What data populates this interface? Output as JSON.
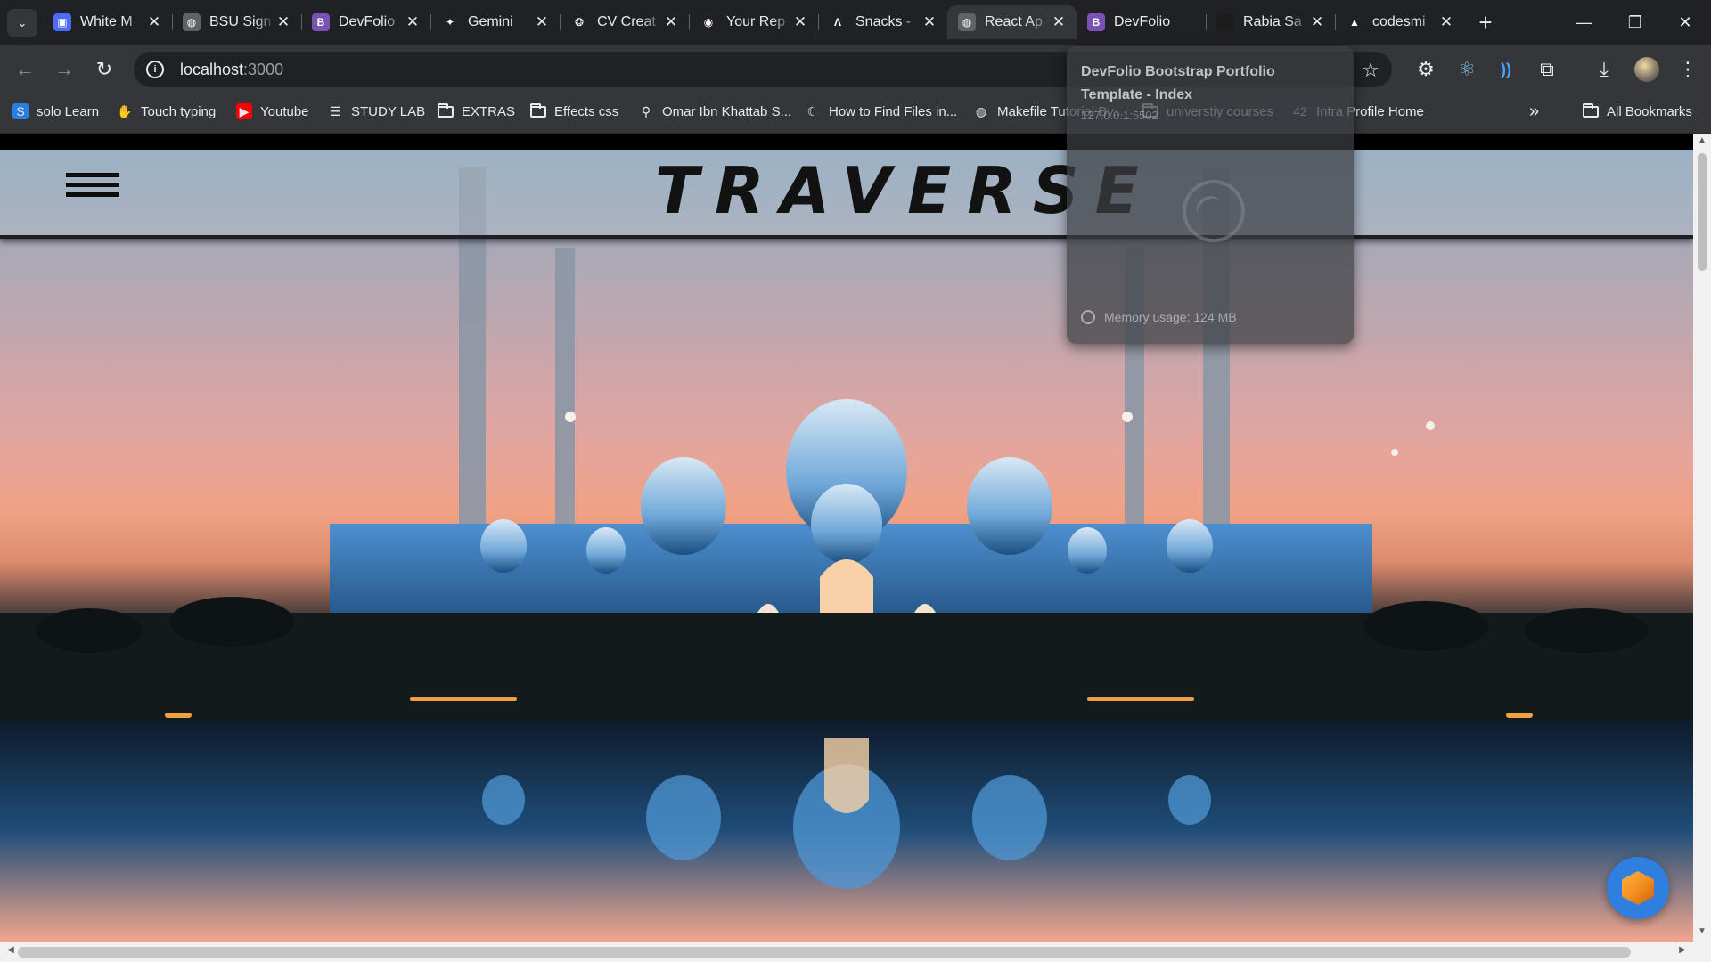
{
  "browser": {
    "tabs": [
      {
        "title": "White M",
        "favicon": "white-m-icon",
        "color": "#4a6cf7",
        "glyph": "▣",
        "active": false
      },
      {
        "title": "BSU Sign",
        "favicon": "globe-icon",
        "color": "#5f6368",
        "glyph": "◍",
        "active": false
      },
      {
        "title": "DevFolio",
        "favicon": "bootstrap-icon",
        "color": "#7952b3",
        "glyph": "B",
        "active": false
      },
      {
        "title": "Gemini",
        "favicon": "gemini-icon",
        "color": "transparent",
        "glyph": "✦",
        "active": false
      },
      {
        "title": "CV Creat",
        "favicon": "openai-icon",
        "color": "transparent",
        "glyph": "❂",
        "active": false
      },
      {
        "title": "Your Rep",
        "favicon": "github-icon",
        "color": "transparent",
        "glyph": "◉",
        "active": false
      },
      {
        "title": "Snacks -",
        "favicon": "snacks-icon",
        "color": "transparent",
        "glyph": "Λ",
        "active": false
      },
      {
        "title": "React Ap",
        "favicon": "globe-icon",
        "color": "#5f6368",
        "glyph": "◍",
        "active": true
      },
      {
        "title": "DevFolio",
        "favicon": "bootstrap-icon",
        "color": "#7952b3",
        "glyph": "B",
        "active": false
      },
      {
        "title": "Rabia Sa",
        "favicon": "dark-circle-icon",
        "color": "#1c1c1c",
        "glyph": "",
        "active": false
      },
      {
        "title": "codesmi",
        "favicon": "codesmith-icon",
        "color": "transparent",
        "glyph": "▲",
        "active": false
      }
    ],
    "new_tab_label": "+",
    "window_controls": {
      "minimize": "—",
      "restore": "❐",
      "close": "✕"
    },
    "address_bar": {
      "host": "localhost",
      "port": ":3000"
    },
    "nav": {
      "back": "←",
      "forward": "→",
      "reload": "↻"
    },
    "star": "☆",
    "extensions": [
      "⚙",
      "⚛",
      "))",
      "⧉"
    ],
    "download": "⤓",
    "menu": "⋮"
  },
  "bookmarks": {
    "items": [
      {
        "label": "solo Learn",
        "icon": "sololearn-icon",
        "glyph": "S",
        "color": "#2a7de1"
      },
      {
        "label": "Touch typing",
        "icon": "hand-icon",
        "glyph": "✋",
        "color": "transparent"
      },
      {
        "label": "Youtube",
        "icon": "youtube-icon",
        "glyph": "▶",
        "color": "#ff0000"
      },
      {
        "label": "STUDY LAB",
        "icon": "list-icon",
        "glyph": "☰",
        "color": "transparent"
      },
      {
        "label": "EXTRAS",
        "icon": "folder-icon",
        "glyph": "",
        "color": "transparent"
      },
      {
        "label": "Effects css",
        "icon": "folder-icon",
        "glyph": "",
        "color": "transparent"
      },
      {
        "label": "Omar Ibn Khattab S...",
        "icon": "pin-icon",
        "glyph": "⚲",
        "color": "transparent"
      },
      {
        "label": "How to Find Files in...",
        "icon": "crescent-icon",
        "glyph": "☾",
        "color": "transparent"
      },
      {
        "label": "Makefile Tutorial By...",
        "icon": "globe-icon",
        "glyph": "◍",
        "color": "transparent"
      },
      {
        "label": "universtiy courses",
        "icon": "folder-icon",
        "glyph": "",
        "color": "transparent"
      },
      {
        "label": "Intra Profile Home",
        "icon": "42-icon",
        "glyph": "42",
        "color": "transparent"
      }
    ],
    "overflow": "»",
    "all_bookmarks": "All Bookmarks"
  },
  "page": {
    "brand": "TRAVERSE",
    "header_bg": "rgba(190,200,210,0.32)"
  },
  "hovercard": {
    "title": "DevFolio Bootstrap Portfolio Template - Index",
    "url": "127.0.0.1:5502",
    "memory": "Memory usage: 124 MB"
  }
}
